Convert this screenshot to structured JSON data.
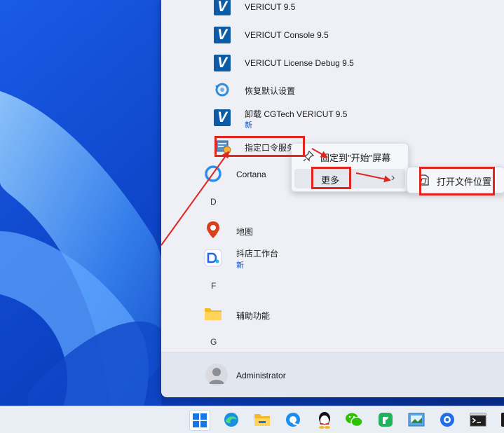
{
  "start_menu": {
    "apps": [
      {
        "name": "VERICUT 9.5",
        "icon": "vericut-logo-icon"
      },
      {
        "name": "VERICUT Console 9.5",
        "icon": "vericut-logo-icon"
      },
      {
        "name": "VERICUT License Debug 9.5",
        "icon": "vericut-logo-icon"
      },
      {
        "name": "恢复默认设置",
        "icon": "restore-icon"
      },
      {
        "name": "卸载 CGTech VERICUT 9.5",
        "badge": "新",
        "icon": "vericut-logo-icon"
      },
      {
        "name": "指定口令服务",
        "icon": "license-server-icon"
      },
      {
        "name": "Cortana",
        "icon": "cortana-icon"
      },
      {
        "name": "地图",
        "icon": "maps-icon"
      },
      {
        "name": "抖店工作台",
        "badge": "新",
        "icon": "doudian-icon"
      },
      {
        "name": "辅助功能",
        "icon": "folder-icon"
      }
    ],
    "letters": [
      "D",
      "F",
      "G"
    ],
    "user": {
      "name": "Administrator"
    }
  },
  "context_menu": {
    "pin_label": "固定到\"开始\"屏幕",
    "more_label": "更多",
    "more_chevron": "›"
  },
  "submenu": {
    "open_location_label": "打开文件位置"
  },
  "taskbar": {
    "icons": [
      "windows-start-icon",
      "edge-icon",
      "file-explorer-icon",
      "browser-icon",
      "qq-icon",
      "wechat-icon",
      "app-green-icon",
      "image-app-icon",
      "app-blue-icon",
      "terminal-icon",
      "app-dark-icon"
    ]
  },
  "colors": {
    "annotation_red": "#e0261f",
    "accent_blue": "#0b57d0",
    "vericut_blue": "#0d5ba6"
  }
}
